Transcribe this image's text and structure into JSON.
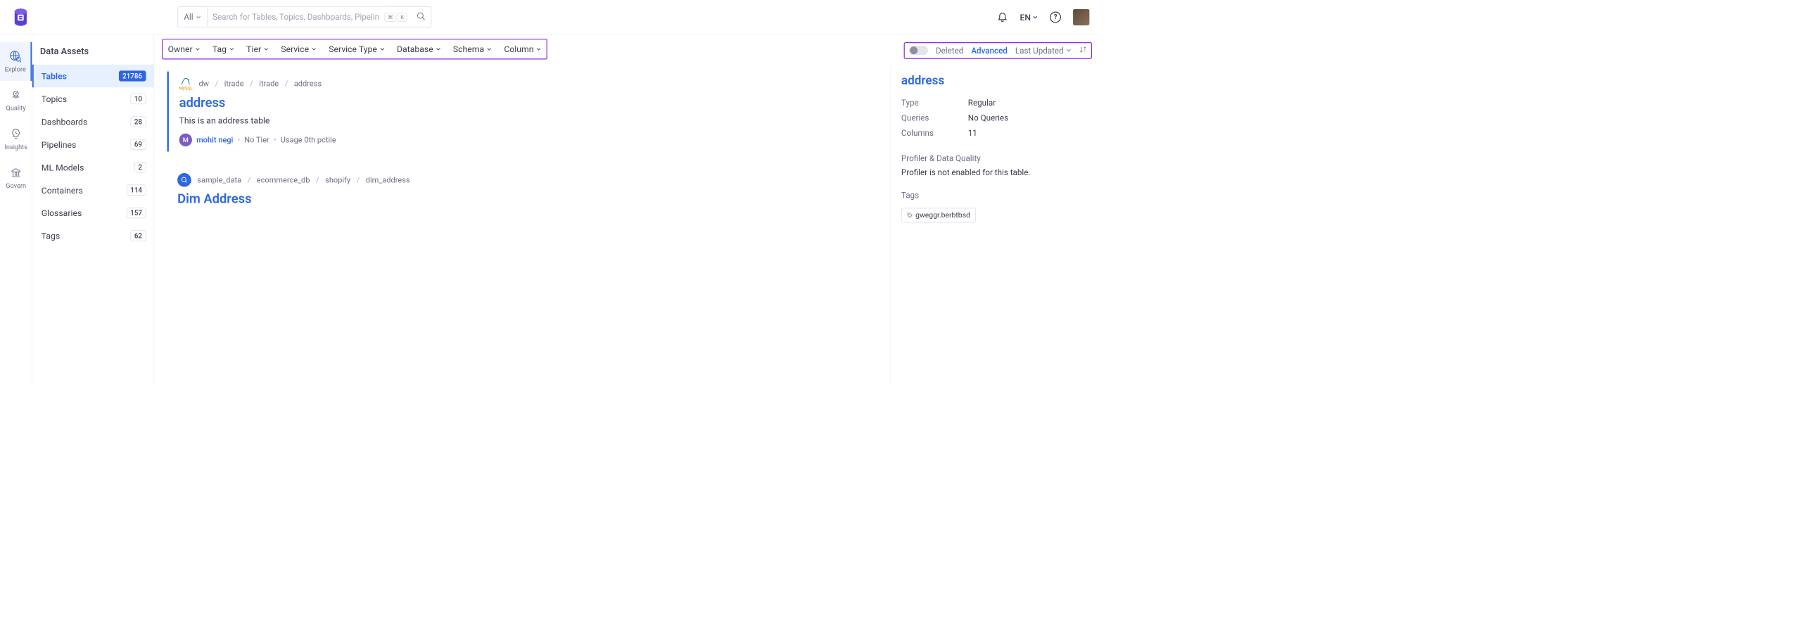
{
  "header": {
    "search_all": "All",
    "search_placeholder": "Search for Tables, Topics, Dashboards, Pipelin…",
    "kbd1": "⌘",
    "kbd2": "K",
    "lang": "EN"
  },
  "rail": {
    "items": [
      {
        "label": "Explore"
      },
      {
        "label": "Quality"
      },
      {
        "label": "Insights"
      },
      {
        "label": "Govern"
      }
    ]
  },
  "sidebar": {
    "title": "Data Assets",
    "items": [
      {
        "label": "Tables",
        "count": "21786"
      },
      {
        "label": "Topics",
        "count": "10"
      },
      {
        "label": "Dashboards",
        "count": "28"
      },
      {
        "label": "Pipelines",
        "count": "69"
      },
      {
        "label": "ML Models",
        "count": "2"
      },
      {
        "label": "Containers",
        "count": "114"
      },
      {
        "label": "Glossaries",
        "count": "157"
      },
      {
        "label": "Tags",
        "count": "62"
      }
    ]
  },
  "filters": [
    "Owner",
    "Tag",
    "Tier",
    "Service",
    "Service Type",
    "Database",
    "Schema",
    "Column"
  ],
  "toolbar": {
    "deleted": "Deleted",
    "advanced": "Advanced",
    "sort": "Last Updated"
  },
  "results": [
    {
      "icon_label": "MySQL",
      "breadcrumb": [
        "dw",
        "itrade",
        "itrade",
        "address"
      ],
      "title": "address",
      "description": "This is an address table",
      "owner_initial": "M",
      "owner_name": "mohit negi",
      "tier": "No Tier",
      "usage": "Usage 0th pctile"
    },
    {
      "breadcrumb": [
        "sample_data",
        "ecommerce_db",
        "shopify",
        "dim_address"
      ],
      "title": "Dim Address"
    }
  ],
  "detail": {
    "title": "address",
    "rows": [
      {
        "key": "Type",
        "val": "Regular"
      },
      {
        "key": "Queries",
        "val": "No Queries"
      },
      {
        "key": "Columns",
        "val": "11"
      }
    ],
    "profiler_heading": "Profiler & Data Quality",
    "profiler_text": "Profiler is not enabled for this table.",
    "tags_heading": "Tags",
    "tags": [
      "gweggr.berbtbsd"
    ]
  }
}
